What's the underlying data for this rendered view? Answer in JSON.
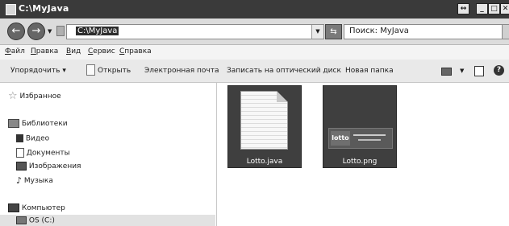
{
  "window": {
    "title": "C:\\MyJava",
    "buttons": [
      "↔",
      "_",
      "□",
      "✕"
    ]
  },
  "address": {
    "path": "C:\\MyJava",
    "search_placeholder": "Поиск: MyJava"
  },
  "menu": {
    "items": [
      {
        "first": "Ф",
        "rest": "айл"
      },
      {
        "first": "П",
        "rest": "равка"
      },
      {
        "first": "В",
        "rest": "ид"
      },
      {
        "first": "С",
        "rest": "ервис"
      },
      {
        "first": "С",
        "rest": "правка"
      }
    ]
  },
  "toolbar": {
    "organize": "Упорядочить",
    "open": "Открыть",
    "email": "Электронная почта",
    "burn": "Записать на оптический диск",
    "new_folder": "Новая папка"
  },
  "nav": {
    "favorites": "Избранное",
    "libraries": "Библиотеки",
    "video": "Видео",
    "documents": "Документы",
    "images": "Изображения",
    "music": "Музыка",
    "computer": "Компьютер",
    "drive_c": "OS (C:)"
  },
  "files": [
    {
      "name": "Lotto.java",
      "icon": "java-file-icon"
    },
    {
      "name": "Lotto.png",
      "icon": "png-image-icon",
      "logo_text": "lotto"
    }
  ]
}
